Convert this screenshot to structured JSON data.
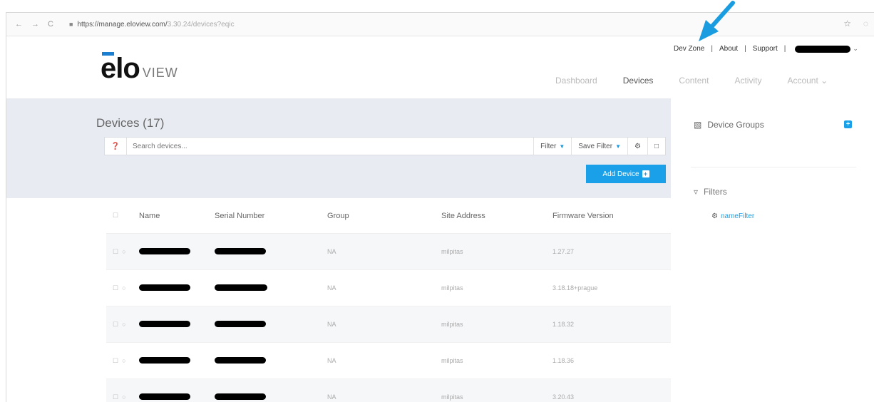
{
  "browser": {
    "url_prefix": "https://manage.eloview.com/",
    "url_rest": "3.30.24/devices?eqic",
    "lock_icon": "lock-icon",
    "star_icon": "star-icon"
  },
  "logo": {
    "brand": "elo",
    "sub": "VIEW"
  },
  "toplinks": {
    "dev_zone": "Dev Zone",
    "sep": "|",
    "about": "About",
    "support": "Support",
    "caret": "⌄"
  },
  "mainnav": {
    "dashboard": "Dashboard",
    "devices": "Devices",
    "content": "Content",
    "activity": "Activity",
    "account": "Account ⌄"
  },
  "devices": {
    "title": "Devices (17)",
    "search_placeholder": "Search devices...",
    "filter_label": "Filter",
    "save_filter_label": "Save Filter",
    "caret": "▼",
    "add_device_label": "Add Device",
    "add_plus": "+"
  },
  "table": {
    "headers": {
      "name": "Name",
      "serial": "Serial Number",
      "group": "Group",
      "site": "Site Address",
      "firmware": "Firmware Version"
    },
    "rows": [
      {
        "group": "NA",
        "site": "milpitas",
        "firmware": "1.27.27"
      },
      {
        "group": "NA",
        "site": "milpitas",
        "firmware": "3.18.18+prague"
      },
      {
        "group": "NA",
        "site": "milpitas",
        "firmware": "1.18.32"
      },
      {
        "group": "NA",
        "site": "milpitas",
        "firmware": "1.18.36"
      },
      {
        "group": "NA",
        "site": "milpitas",
        "firmware": "3.20.43"
      }
    ]
  },
  "side": {
    "device_groups_label": "Device Groups",
    "add_plus": "+",
    "filters_label": "Filters",
    "filter_item": "nameFilter"
  },
  "colors": {
    "accent": "#1aa0e8",
    "band": "#e8ecf2",
    "arrow": "#1a9ce0"
  }
}
